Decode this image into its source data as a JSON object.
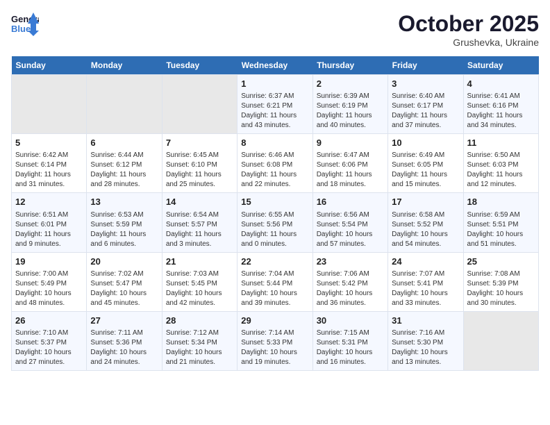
{
  "logo": {
    "line1": "General",
    "line2": "Blue"
  },
  "title": "October 2025",
  "location": "Grushevka, Ukraine",
  "days_of_week": [
    "Sunday",
    "Monday",
    "Tuesday",
    "Wednesday",
    "Thursday",
    "Friday",
    "Saturday"
  ],
  "weeks": [
    [
      {
        "day": "",
        "text": ""
      },
      {
        "day": "",
        "text": ""
      },
      {
        "day": "",
        "text": ""
      },
      {
        "day": "1",
        "text": "Sunrise: 6:37 AM\nSunset: 6:21 PM\nDaylight: 11 hours\nand 43 minutes."
      },
      {
        "day": "2",
        "text": "Sunrise: 6:39 AM\nSunset: 6:19 PM\nDaylight: 11 hours\nand 40 minutes."
      },
      {
        "day": "3",
        "text": "Sunrise: 6:40 AM\nSunset: 6:17 PM\nDaylight: 11 hours\nand 37 minutes."
      },
      {
        "day": "4",
        "text": "Sunrise: 6:41 AM\nSunset: 6:16 PM\nDaylight: 11 hours\nand 34 minutes."
      }
    ],
    [
      {
        "day": "5",
        "text": "Sunrise: 6:42 AM\nSunset: 6:14 PM\nDaylight: 11 hours\nand 31 minutes."
      },
      {
        "day": "6",
        "text": "Sunrise: 6:44 AM\nSunset: 6:12 PM\nDaylight: 11 hours\nand 28 minutes."
      },
      {
        "day": "7",
        "text": "Sunrise: 6:45 AM\nSunset: 6:10 PM\nDaylight: 11 hours\nand 25 minutes."
      },
      {
        "day": "8",
        "text": "Sunrise: 6:46 AM\nSunset: 6:08 PM\nDaylight: 11 hours\nand 22 minutes."
      },
      {
        "day": "9",
        "text": "Sunrise: 6:47 AM\nSunset: 6:06 PM\nDaylight: 11 hours\nand 18 minutes."
      },
      {
        "day": "10",
        "text": "Sunrise: 6:49 AM\nSunset: 6:05 PM\nDaylight: 11 hours\nand 15 minutes."
      },
      {
        "day": "11",
        "text": "Sunrise: 6:50 AM\nSunset: 6:03 PM\nDaylight: 11 hours\nand 12 minutes."
      }
    ],
    [
      {
        "day": "12",
        "text": "Sunrise: 6:51 AM\nSunset: 6:01 PM\nDaylight: 11 hours\nand 9 minutes."
      },
      {
        "day": "13",
        "text": "Sunrise: 6:53 AM\nSunset: 5:59 PM\nDaylight: 11 hours\nand 6 minutes."
      },
      {
        "day": "14",
        "text": "Sunrise: 6:54 AM\nSunset: 5:57 PM\nDaylight: 11 hours\nand 3 minutes."
      },
      {
        "day": "15",
        "text": "Sunrise: 6:55 AM\nSunset: 5:56 PM\nDaylight: 11 hours\nand 0 minutes."
      },
      {
        "day": "16",
        "text": "Sunrise: 6:56 AM\nSunset: 5:54 PM\nDaylight: 10 hours\nand 57 minutes."
      },
      {
        "day": "17",
        "text": "Sunrise: 6:58 AM\nSunset: 5:52 PM\nDaylight: 10 hours\nand 54 minutes."
      },
      {
        "day": "18",
        "text": "Sunrise: 6:59 AM\nSunset: 5:51 PM\nDaylight: 10 hours\nand 51 minutes."
      }
    ],
    [
      {
        "day": "19",
        "text": "Sunrise: 7:00 AM\nSunset: 5:49 PM\nDaylight: 10 hours\nand 48 minutes."
      },
      {
        "day": "20",
        "text": "Sunrise: 7:02 AM\nSunset: 5:47 PM\nDaylight: 10 hours\nand 45 minutes."
      },
      {
        "day": "21",
        "text": "Sunrise: 7:03 AM\nSunset: 5:45 PM\nDaylight: 10 hours\nand 42 minutes."
      },
      {
        "day": "22",
        "text": "Sunrise: 7:04 AM\nSunset: 5:44 PM\nDaylight: 10 hours\nand 39 minutes."
      },
      {
        "day": "23",
        "text": "Sunrise: 7:06 AM\nSunset: 5:42 PM\nDaylight: 10 hours\nand 36 minutes."
      },
      {
        "day": "24",
        "text": "Sunrise: 7:07 AM\nSunset: 5:41 PM\nDaylight: 10 hours\nand 33 minutes."
      },
      {
        "day": "25",
        "text": "Sunrise: 7:08 AM\nSunset: 5:39 PM\nDaylight: 10 hours\nand 30 minutes."
      }
    ],
    [
      {
        "day": "26",
        "text": "Sunrise: 7:10 AM\nSunset: 5:37 PM\nDaylight: 10 hours\nand 27 minutes."
      },
      {
        "day": "27",
        "text": "Sunrise: 7:11 AM\nSunset: 5:36 PM\nDaylight: 10 hours\nand 24 minutes."
      },
      {
        "day": "28",
        "text": "Sunrise: 7:12 AM\nSunset: 5:34 PM\nDaylight: 10 hours\nand 21 minutes."
      },
      {
        "day": "29",
        "text": "Sunrise: 7:14 AM\nSunset: 5:33 PM\nDaylight: 10 hours\nand 19 minutes."
      },
      {
        "day": "30",
        "text": "Sunrise: 7:15 AM\nSunset: 5:31 PM\nDaylight: 10 hours\nand 16 minutes."
      },
      {
        "day": "31",
        "text": "Sunrise: 7:16 AM\nSunset: 5:30 PM\nDaylight: 10 hours\nand 13 minutes."
      },
      {
        "day": "",
        "text": ""
      }
    ]
  ]
}
